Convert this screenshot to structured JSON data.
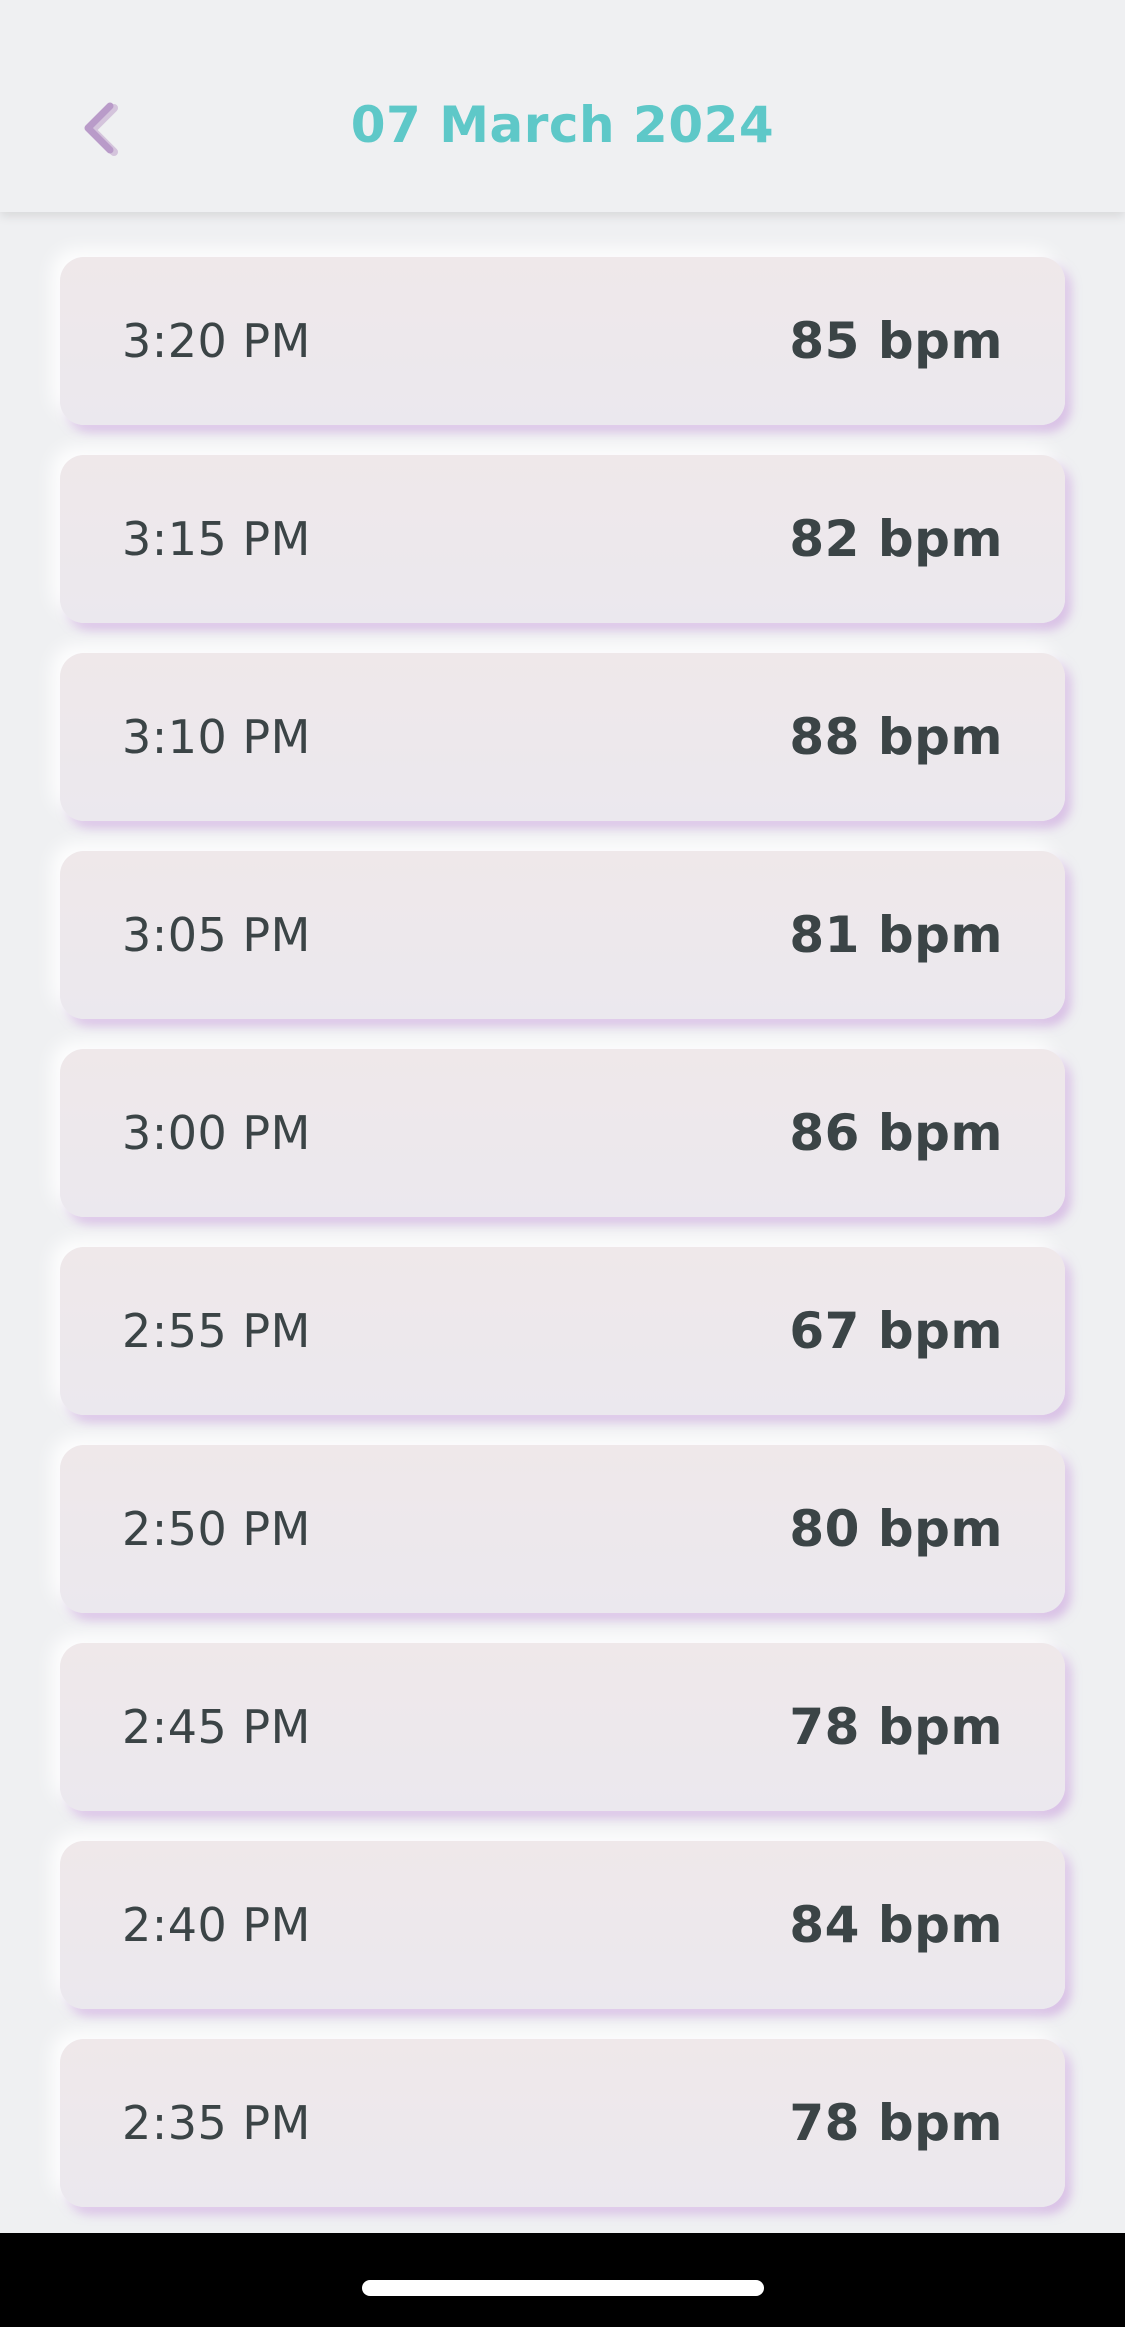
{
  "header": {
    "title": "07 March 2024",
    "back_icon": "chevron-left-icon"
  },
  "colors": {
    "title": "#5ec8c8",
    "back_icon": "#b99bc9",
    "text": "#3b4446",
    "card_shadow": "#c496da",
    "background": "#eff0f2"
  },
  "readings": [
    {
      "time": "3:20 PM",
      "bpm": "85 bpm"
    },
    {
      "time": "3:15 PM",
      "bpm": "82 bpm"
    },
    {
      "time": "3:10 PM",
      "bpm": "88 bpm"
    },
    {
      "time": "3:05 PM",
      "bpm": "81 bpm"
    },
    {
      "time": "3:00 PM",
      "bpm": "86 bpm"
    },
    {
      "time": "2:55 PM",
      "bpm": "67 bpm"
    },
    {
      "time": "2:50 PM",
      "bpm": "80 bpm"
    },
    {
      "time": "2:45 PM",
      "bpm": "78 bpm"
    },
    {
      "time": "2:40 PM",
      "bpm": "84 bpm"
    },
    {
      "time": "2:35 PM",
      "bpm": "78 bpm"
    }
  ]
}
